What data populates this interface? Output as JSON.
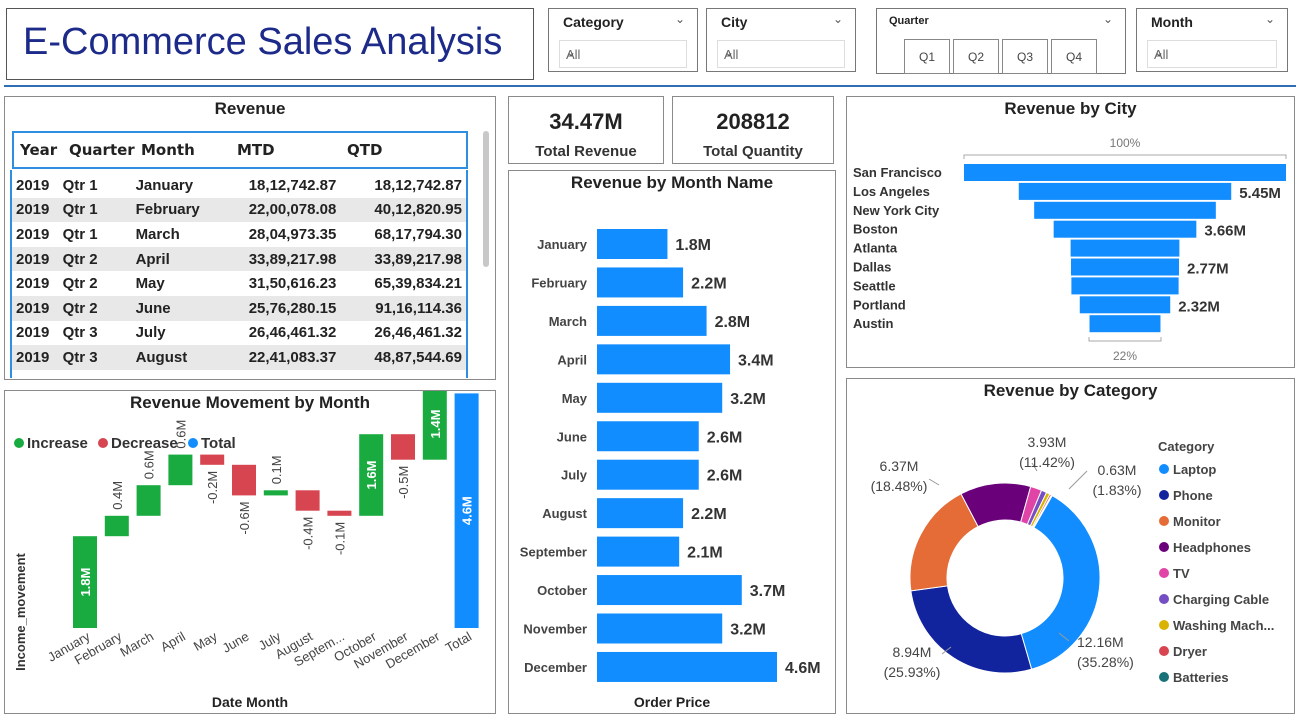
{
  "header": {
    "title": "E-Commerce Sales Analysis"
  },
  "slicers": {
    "category": {
      "label": "Category",
      "value": "All"
    },
    "city": {
      "label": "City",
      "value": "All"
    },
    "quarter": {
      "label": "Quarter",
      "buttons": [
        "Q1",
        "Q2",
        "Q3",
        "Q4"
      ]
    },
    "month": {
      "label": "Month",
      "value": "All"
    }
  },
  "cards": {
    "total_revenue": {
      "value": "34.47M",
      "label": "Total Revenue"
    },
    "total_quantity": {
      "value": "208812",
      "label": "Total Quantity"
    }
  },
  "revenue_table": {
    "title": "Revenue",
    "columns": [
      "Year",
      "Quarter",
      "Month",
      "MTD",
      "QTD"
    ],
    "rows": [
      [
        "2019",
        "Qtr 1",
        "January",
        "18,12,742.87",
        "18,12,742.87"
      ],
      [
        "2019",
        "Qtr 1",
        "February",
        "22,00,078.08",
        "40,12,820.95"
      ],
      [
        "2019",
        "Qtr 1",
        "March",
        "28,04,973.35",
        "68,17,794.30"
      ],
      [
        "2019",
        "Qtr 2",
        "April",
        "33,89,217.98",
        "33,89,217.98"
      ],
      [
        "2019",
        "Qtr 2",
        "May",
        "31,50,616.23",
        "65,39,834.21"
      ],
      [
        "2019",
        "Qtr 2",
        "June",
        "25,76,280.15",
        "91,16,114.36"
      ],
      [
        "2019",
        "Qtr 3",
        "July",
        "26,46,461.32",
        "26,46,461.32"
      ],
      [
        "2019",
        "Qtr 3",
        "August",
        "22,41,083.37",
        "48,87,544.69"
      ]
    ]
  },
  "colors": {
    "blue": "#118dff",
    "green": "#1aab40",
    "red": "#d64550",
    "title_blue": "#1c2a8a"
  },
  "chart_data": [
    {
      "id": "month_bars",
      "type": "bar",
      "title": "Revenue by Month Name",
      "xlabel": "Order Price",
      "categories": [
        "January",
        "February",
        "March",
        "April",
        "May",
        "June",
        "July",
        "August",
        "September",
        "October",
        "November",
        "December"
      ],
      "values": [
        1.8,
        2.2,
        2.8,
        3.4,
        3.2,
        2.6,
        2.6,
        2.2,
        2.1,
        3.7,
        3.2,
        4.6
      ],
      "labels": [
        "1.8M",
        "2.2M",
        "2.8M",
        "3.4M",
        "3.2M",
        "2.6M",
        "2.6M",
        "2.2M",
        "2.1M",
        "3.7M",
        "3.2M",
        "4.6M"
      ]
    },
    {
      "id": "city_funnel",
      "type": "bar",
      "title": "Revenue by City",
      "top_label": "100%",
      "bottom_label": "22%",
      "categories": [
        "San Francisco",
        "Los Angeles",
        "New York City",
        "Boston",
        "Atlanta",
        "Dallas",
        "Seattle",
        "Portland",
        "Austin"
      ],
      "values": [
        8.26,
        5.45,
        4.66,
        3.66,
        2.79,
        2.77,
        2.75,
        2.32,
        1.82
      ],
      "labels": [
        "",
        "5.45M",
        "",
        "3.66M",
        "",
        "2.77M",
        "",
        "2.32M",
        ""
      ]
    },
    {
      "id": "waterfall",
      "type": "bar",
      "title": "Revenue Movement by Month",
      "xlabel": "Date Month",
      "ylabel": "Income_movement",
      "legend": [
        "Increase",
        "Decrease",
        "Total"
      ],
      "categories": [
        "January",
        "February",
        "March",
        "April",
        "May",
        "June",
        "July",
        "August",
        "Septem...",
        "October",
        "November",
        "December",
        "Total"
      ],
      "values": [
        1.8,
        0.4,
        0.6,
        0.6,
        -0.2,
        -0.6,
        0.1,
        -0.4,
        -0.1,
        1.6,
        -0.5,
        1.4,
        4.6
      ],
      "labels": [
        "1.8M",
        "0.4M",
        "0.6M",
        "0.6M",
        "-0.2M",
        "-0.6M",
        "0.1M",
        "-0.4M",
        "-0.1M",
        "1.6M",
        "-0.5M",
        "1.4M",
        "4.6M"
      ]
    },
    {
      "id": "category_donut",
      "type": "pie",
      "title": "Revenue by Category",
      "legend_title": "Category",
      "categories": [
        "Laptop",
        "Phone",
        "Monitor",
        "Headphones",
        "TV",
        "Charging Cable",
        "Washing Mach...",
        "Dryer",
        "Batteries"
      ],
      "values": [
        12.16,
        8.94,
        6.37,
        3.93,
        0.63,
        0.3,
        0.2,
        0.1,
        0.05
      ],
      "colors": [
        "#118dff",
        "#12239e",
        "#e66c37",
        "#6b007b",
        "#e044a7",
        "#744ec2",
        "#d9b300",
        "#d64550",
        "#197278"
      ],
      "annotations": [
        {
          "value": "12.16M",
          "pct": "(35.28%)"
        },
        {
          "value": "8.94M",
          "pct": "(25.93%)"
        },
        {
          "value": "6.37M",
          "pct": "(18.48%)"
        },
        {
          "value": "3.93M",
          "pct": "(11.42%)"
        },
        {
          "value": "0.63M",
          "pct": "(1.83%)"
        }
      ]
    }
  ]
}
